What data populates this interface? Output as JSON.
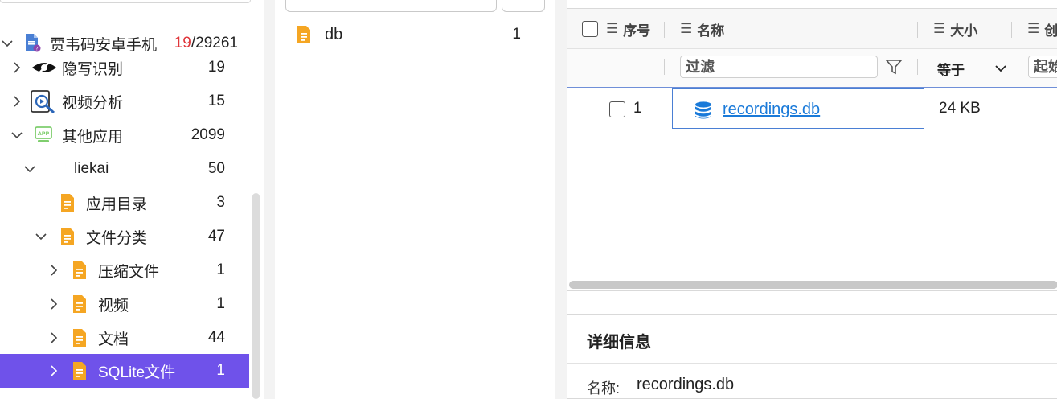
{
  "tree": {
    "items": [
      {
        "label": "贾韦码安卓手机",
        "count_highlight": "19",
        "count_rest": "/29261",
        "icon": "phone-document-icon"
      },
      {
        "label": "隐写识别",
        "count": "19",
        "icon": "eye-slash-icon"
      },
      {
        "label": "视频分析",
        "count": "15",
        "icon": "video-search-icon"
      },
      {
        "label": "其他应用",
        "count": "2099",
        "icon": "app-icon"
      },
      {
        "label": "liekai",
        "count": "50"
      },
      {
        "label": "应用目录",
        "count": "3",
        "icon": "file-icon"
      },
      {
        "label": "文件分类",
        "count": "47",
        "icon": "file-icon"
      },
      {
        "label": "压缩文件",
        "count": "1",
        "icon": "file-icon"
      },
      {
        "label": "视频",
        "count": "1",
        "icon": "file-icon"
      },
      {
        "label": "文档",
        "count": "44",
        "icon": "file-icon"
      },
      {
        "label": "SQLite文件",
        "count": "1",
        "icon": "file-icon"
      }
    ]
  },
  "middle": {
    "item": {
      "label": "db",
      "count": "1",
      "icon": "file-icon"
    }
  },
  "grid": {
    "headers": {
      "index": "序号",
      "name": "名称",
      "size": "大小",
      "created": "创"
    },
    "filter": {
      "name_placeholder": "过滤",
      "operator": "等于",
      "start": "起始"
    },
    "rows": [
      {
        "index": "1",
        "name": "recordings.db",
        "size": "24 KB",
        "icon": "database-icon"
      }
    ]
  },
  "detail": {
    "title": "详细信息",
    "name_key": "名称:",
    "name_value": "recordings.db"
  },
  "colors": {
    "accent": "#6f52ea",
    "file_icon": "#f5a623",
    "link": "#1a7ad9",
    "count_highlight": "#e0353a"
  }
}
